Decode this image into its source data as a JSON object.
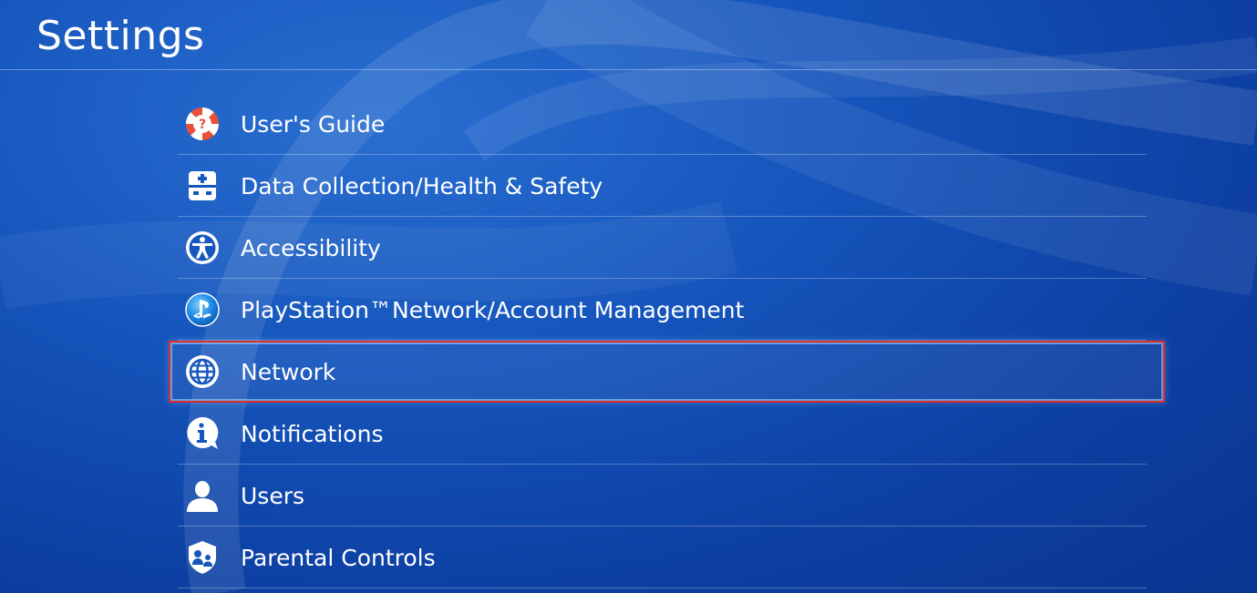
{
  "page": {
    "title": "Settings"
  },
  "menu": {
    "items": [
      {
        "label": "User's Guide",
        "icon": "lifebuoy-help-icon",
        "selected": false
      },
      {
        "label": "Data Collection/Health & Safety",
        "icon": "first-aid-kit-icon",
        "selected": false
      },
      {
        "label": "Accessibility",
        "icon": "accessibility-icon",
        "selected": false
      },
      {
        "label": "PlayStation™Network/Account Management",
        "icon": "playstation-network-icon",
        "selected": false
      },
      {
        "label": "Network",
        "icon": "globe-icon",
        "selected": true
      },
      {
        "label": "Notifications",
        "icon": "info-bubble-icon",
        "selected": false
      },
      {
        "label": "Users",
        "icon": "user-icon",
        "selected": false
      },
      {
        "label": "Parental Controls",
        "icon": "parental-controls-shield-icon",
        "selected": false
      }
    ]
  },
  "colors": {
    "background": "#1656bd",
    "text": "#ffffff",
    "highlight_border": "#e02a2a",
    "focus_glow": "#a0dcff"
  }
}
